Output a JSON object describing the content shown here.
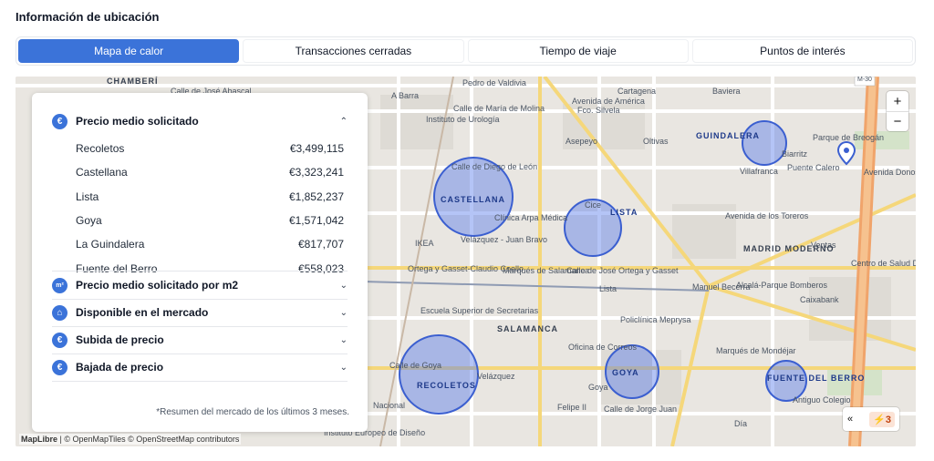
{
  "section_title": "Información de ubicación",
  "tabs": [
    {
      "label": "Mapa de calor",
      "active": true
    },
    {
      "label": "Transacciones cerradas",
      "active": false
    },
    {
      "label": "Tiempo de viaje",
      "active": false
    },
    {
      "label": "Puntos de interés",
      "active": false
    }
  ],
  "panel": {
    "price_section": {
      "icon": "euro-icon",
      "icon_glyph": "€",
      "label": "Precio medio solicitado",
      "rows": [
        {
          "name": "Recoletos",
          "value": "€3,499,115"
        },
        {
          "name": "Castellana",
          "value": "€3,323,241"
        },
        {
          "name": "Lista",
          "value": "€1,852,237"
        },
        {
          "name": "Goya",
          "value": "€1,571,042"
        },
        {
          "name": "La Guindalera",
          "value": "€817,707"
        },
        {
          "name": "Fuente del Berro",
          "value": "€558,023"
        }
      ]
    },
    "sections": [
      {
        "label": "Precio medio solicitado por m2",
        "icon": "square-meter-icon",
        "glyph": "m²"
      },
      {
        "label": "Disponible en el mercado",
        "icon": "house-icon",
        "glyph": "⌂"
      },
      {
        "label": "Subida de precio",
        "icon": "euro-up-icon",
        "glyph": "€"
      },
      {
        "label": "Bajada de precio",
        "icon": "euro-down-icon",
        "glyph": "€"
      }
    ],
    "footnote": "*Resumen del mercado de los últimos 3 meses."
  },
  "map": {
    "zoom_in": "+",
    "zoom_out": "−",
    "collapse_arrow": "«",
    "badge": "⚡3",
    "attribution_brand": "MapLibre",
    "attribution_rest": " | © OpenMapTiles © OpenStreetMap contributors",
    "zones": [
      "CASTELLANA",
      "LISTA",
      "GUINDALERA",
      "RECOLETOS",
      "GOYA",
      "FUENTE DEL BERRO"
    ],
    "districts": [
      "CHAMBERÍ",
      "SALAMANCA",
      "MADRID MODERNO"
    ],
    "labels": [
      "Calle de José Abascal",
      "Pedro de Valdivia",
      "Cartagena",
      "Baviera",
      "Avenida de América",
      "Instituto de Urología",
      "Calle de María de Molina",
      "Asepeyo",
      "Oltivas",
      "Parque de Breogán",
      "Calle de Diego de León",
      "Clínica Arpa Médica",
      "Cice",
      "Villafranca",
      "Puente Calero",
      "Avenida Donostiarra",
      "IKEA",
      "Velázquez - Juan Bravo",
      "Avenida de los Toreros",
      "Ventas",
      "Ortega y Gasset-Claudio Coello",
      "Marqués de Salamanca",
      "Calle de José Ortega y Gasset",
      "Manuel Becerra",
      "Alcalá-Parque Bomberos",
      "Centro de Salud Daroca",
      "Escuela Superior de Secretarias",
      "Policlínica Meprysa",
      "Caixabank",
      "Oficina de Correos",
      "Marqués de Mondéjar",
      "Calle de Goya",
      "Velázquez",
      "Nacional",
      "Felipe II",
      "Calle de Jorge Juan",
      "Antiguo Colegio",
      "Día",
      "Instituto Europeo de Diseño",
      "Biarritz",
      "A Barra",
      "Lista",
      "Goya",
      "Fco. Silvela",
      "M-30"
    ]
  }
}
